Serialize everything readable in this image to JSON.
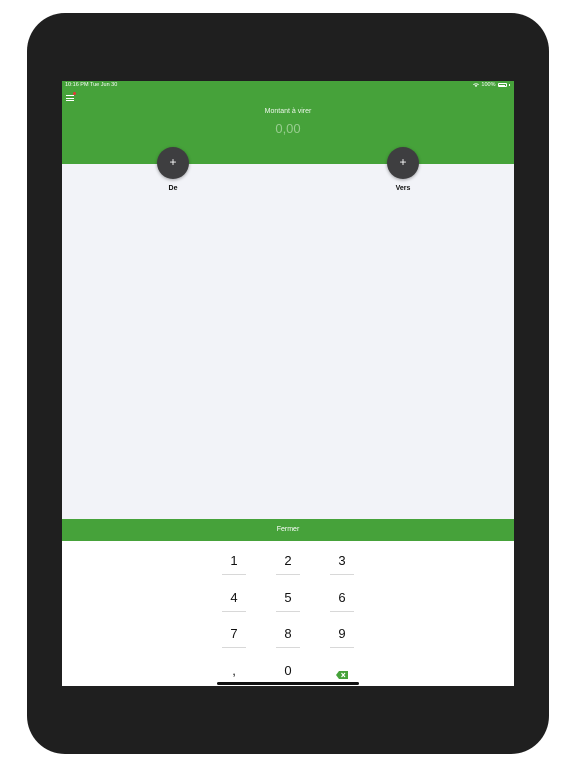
{
  "status_bar": {
    "time": "10:16 PM   Tue Jun 30",
    "battery": "100%"
  },
  "header": {
    "amount_label": "Montant à virer",
    "amount_value": "0,00"
  },
  "accounts": {
    "from": {
      "button": "+",
      "label": "De"
    },
    "to": {
      "button": "+",
      "label": "Vers"
    }
  },
  "close_button": "Fermer",
  "keypad": {
    "keys": [
      "1",
      "2",
      "3",
      "4",
      "5",
      "6",
      "7",
      "8",
      "9",
      ",",
      "0"
    ],
    "backspace_icon": "backspace-icon"
  },
  "colors": {
    "brand_green": "#46a23a",
    "fab": "#3e3e40",
    "bezel": "#1f1f1f"
  }
}
